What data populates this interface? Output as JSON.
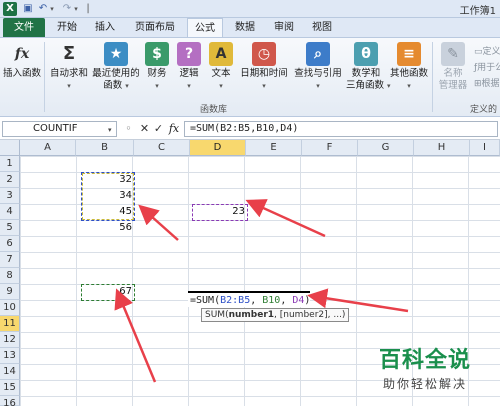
{
  "titlebar": {
    "app_icon": "excel-icon",
    "title": "工作簿1"
  },
  "tabs": [
    {
      "label": "文件"
    },
    {
      "label": "开始"
    },
    {
      "label": "插入"
    },
    {
      "label": "页面布局"
    },
    {
      "label": "公式"
    },
    {
      "label": "数据"
    },
    {
      "label": "审阅"
    },
    {
      "label": "视图"
    }
  ],
  "ribbon": {
    "insert_function": "插入函数",
    "autosum": "自动求和",
    "recent_1": "最近使用的",
    "recent_2": "函数",
    "finance": "财务",
    "logical": "逻辑",
    "text": "文本",
    "datetime": "日期和时间",
    "lookup": "查找与引用",
    "math_1": "数学和",
    "math_2": "三角函数",
    "other": "其他函数",
    "name_1": "名称",
    "name_2": "管理器",
    "group_library": "函数库",
    "group_defined": "定义的",
    "define_name": "定义名",
    "use_in_formula": "用于公",
    "create_from": "根据"
  },
  "formula_bar": {
    "name_box": "COUNTIF",
    "cancel": "✕",
    "enter": "✓",
    "fx": "fx",
    "formula": "=SUM(B2:B5,B10,D4)"
  },
  "grid": {
    "columns": [
      "A",
      "B",
      "C",
      "D",
      "E",
      "F",
      "G",
      "H",
      "I"
    ],
    "rows": [
      "1",
      "2",
      "3",
      "4",
      "5",
      "6",
      "7",
      "8",
      "9",
      "10",
      "11",
      "12",
      "13",
      "14",
      "15",
      "16"
    ],
    "cells": {
      "B2": "32",
      "B3": "34",
      "B4": "45",
      "B5": "56",
      "D4": "23",
      "B10": "67"
    },
    "edit": {
      "prefix": "=SUM(",
      "ref1": "B2:B5",
      "sep1": ", ",
      "ref2": "B10",
      "sep2": ", ",
      "ref3": "D4",
      "suffix": ")"
    },
    "tooltip": {
      "func": "SUM(",
      "arg1": "number1",
      "rest": ", [number2], ...)"
    }
  },
  "watermark": {
    "title": "百科全说",
    "subtitle": "助你轻松解决"
  },
  "colors": {
    "ref1": "#2c4fc7",
    "ref2": "#2e7d32",
    "ref3": "#8a3ab4",
    "arrow": "#e8404a"
  }
}
